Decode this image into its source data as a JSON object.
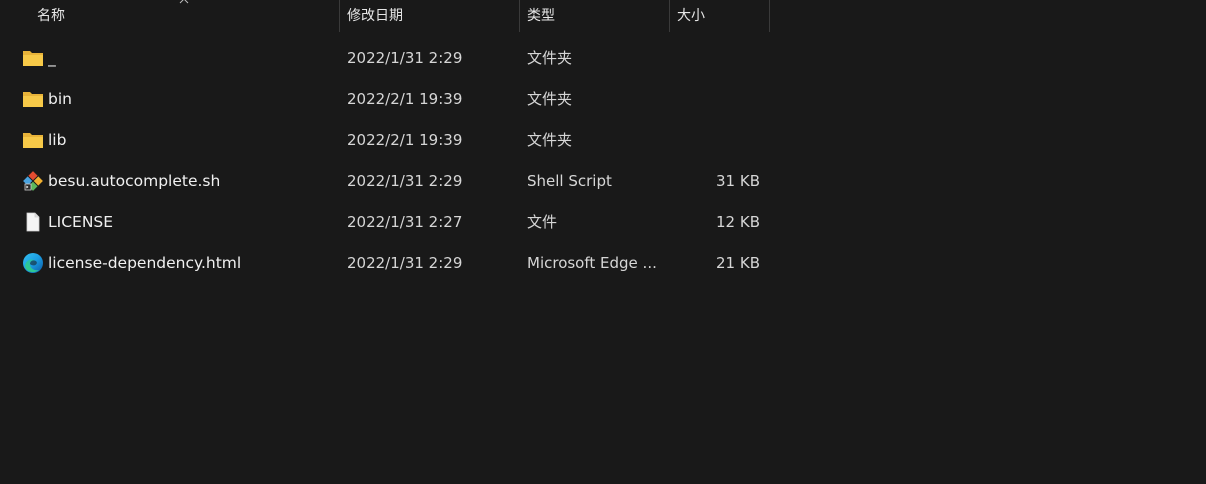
{
  "columns": {
    "name": "名称",
    "date": "修改日期",
    "type": "类型",
    "size": "大小"
  },
  "files": [
    {
      "name": "_",
      "date": "2022/1/31 2:29",
      "type": "文件夹",
      "size": "",
      "icon": "folder-icon"
    },
    {
      "name": "bin",
      "date": "2022/2/1 19:39",
      "type": "文件夹",
      "size": "",
      "icon": "folder-icon"
    },
    {
      "name": "lib",
      "date": "2022/2/1 19:39",
      "type": "文件夹",
      "size": "",
      "icon": "folder-icon"
    },
    {
      "name": "besu.autocomplete.sh",
      "date": "2022/1/31 2:29",
      "type": "Shell Script",
      "size": "31 KB",
      "icon": "git-shell-script-icon"
    },
    {
      "name": "LICENSE",
      "date": "2022/1/31 2:27",
      "type": "文件",
      "size": "12 KB",
      "icon": "blank-file-icon"
    },
    {
      "name": "license-dependency.html",
      "date": "2022/1/31 2:29",
      "type": "Microsoft Edge ...",
      "size": "21 KB",
      "icon": "edge-browser-icon"
    }
  ],
  "colors": {
    "background": "#191919",
    "text": "#e6e6e6",
    "divider": "#3a3a3a",
    "folder": "#f7c948"
  }
}
